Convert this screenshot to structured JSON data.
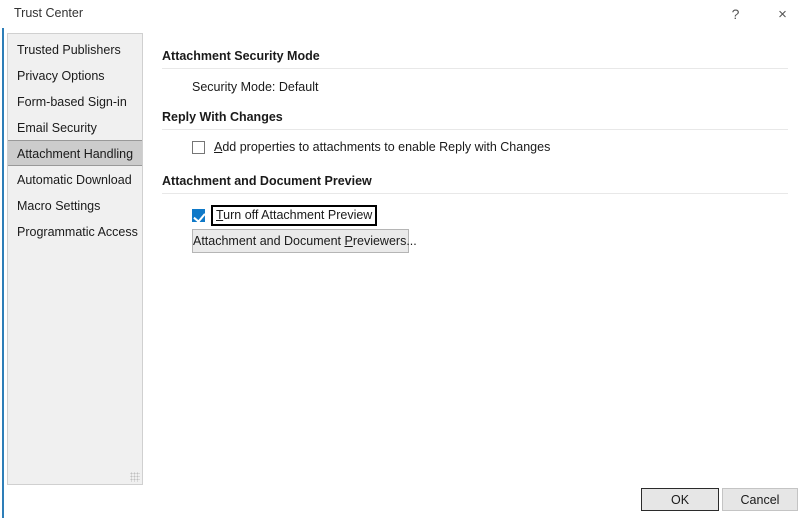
{
  "window": {
    "title": "Trust Center",
    "accent_color": "#2E7EB8",
    "help_icon": "?",
    "close_icon": "×"
  },
  "sidebar": {
    "items": [
      {
        "label": "Trusted Publishers",
        "selected": false
      },
      {
        "label": "Privacy Options",
        "selected": false
      },
      {
        "label": "Form-based Sign-in",
        "selected": false
      },
      {
        "label": "Email Security",
        "selected": false
      },
      {
        "label": "Attachment Handling",
        "selected": true
      },
      {
        "label": "Automatic Download",
        "selected": false
      },
      {
        "label": "Macro Settings",
        "selected": false
      },
      {
        "label": "Programmatic Access",
        "selected": false
      }
    ]
  },
  "main": {
    "sections": [
      {
        "heading": "Attachment Security Mode",
        "status_text": "Security Mode: Default"
      },
      {
        "heading": "Reply With Changes",
        "checkbox": {
          "checked": false,
          "accel": "A",
          "label_rest": "dd properties to attachments to enable Reply with Changes"
        }
      },
      {
        "heading": "Attachment and Document Preview",
        "checkbox": {
          "checked": true,
          "focused": true,
          "accel": "T",
          "label_rest": "urn off Attachment Preview"
        },
        "button": {
          "text_before": "Attachment and Document ",
          "accel": "P",
          "text_after": "reviewers..."
        }
      }
    ]
  },
  "footer": {
    "ok_label": "OK",
    "cancel_label": "Cancel"
  }
}
